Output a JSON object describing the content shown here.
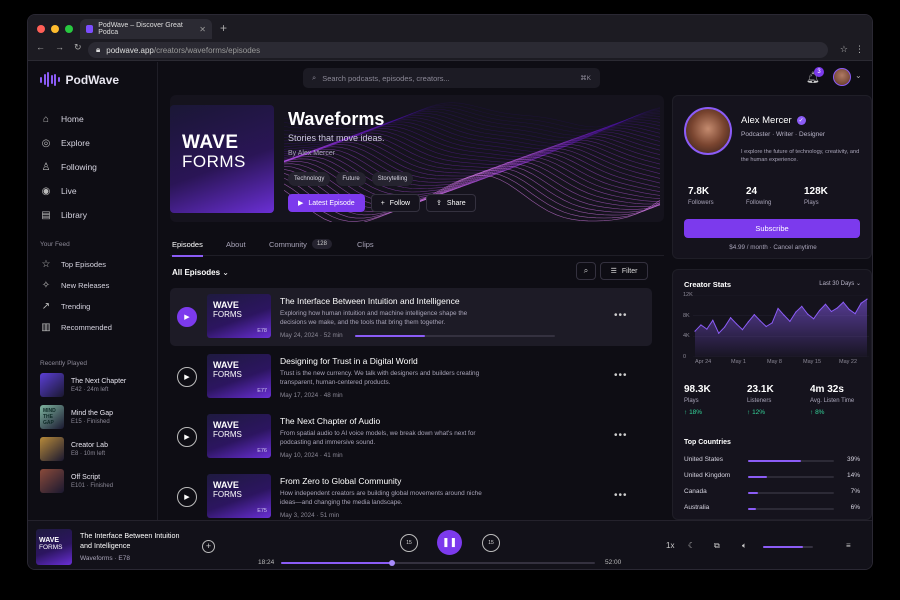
{
  "browser": {
    "tab_title": "PodWave – Discover Great Podca",
    "url_host": "podwave.app",
    "url_path": "/creators/waveforms/episodes"
  },
  "app": {
    "name": "PodWave",
    "accent": "#7c3aed"
  },
  "sidebar": {
    "nav": [
      {
        "label": "Home",
        "icon": "home-icon"
      },
      {
        "label": "Explore",
        "icon": "compass-icon"
      },
      {
        "label": "Following",
        "icon": "user-icon"
      },
      {
        "label": "Live",
        "icon": "live-icon"
      },
      {
        "label": "Library",
        "icon": "library-icon"
      }
    ],
    "feed_heading": "Your Feed",
    "feed": [
      {
        "label": "Top Episodes",
        "icon": "star-icon"
      },
      {
        "label": "New Releases",
        "icon": "sparkle-icon"
      },
      {
        "label": "Trending",
        "icon": "trending-icon"
      },
      {
        "label": "Recommended",
        "icon": "chart-icon"
      }
    ],
    "recent_heading": "Recently Played",
    "recent": [
      {
        "title": "The Next Chapter",
        "ep": "E42",
        "status": "24m left",
        "color": "#5b3fd6"
      },
      {
        "title": "Mind the Gap",
        "ep": "E15",
        "status": "Finished",
        "color": "#7fb5a0",
        "thumb_text": "MIND THE GAP"
      },
      {
        "title": "Creator Lab",
        "ep": "E8",
        "status": "10m left",
        "color": "#b78a3a"
      },
      {
        "title": "Off Script",
        "ep": "E101",
        "status": "Finished",
        "color": "#8a4a3a"
      }
    ]
  },
  "topbar": {
    "search_placeholder": "Search podcasts, episodes, creators...",
    "shortcut": "⌘K",
    "notifications": "3"
  },
  "podcast": {
    "cover_line1": "WAVE",
    "cover_line2": "FORMS",
    "title": "Waveforms",
    "tagline": "Stories that move ideas.",
    "author": "By Alex Mercer",
    "tags": [
      "Technology",
      "Future",
      "Storytelling"
    ],
    "btn_latest": "Latest Episode",
    "btn_follow": "Follow",
    "btn_share": "Share"
  },
  "tabs": [
    {
      "label": "Episodes"
    },
    {
      "label": "About"
    },
    {
      "label": "Community",
      "count": "128"
    },
    {
      "label": "Clips"
    }
  ],
  "filter": {
    "all_label": "All Episodes",
    "filter_label": "Filter"
  },
  "episodes": [
    {
      "title": "The Interface Between Intuition and Intelligence",
      "desc": "Exploring how human intuition and machine intelligence shape the decisions we make, and the tools that bring them together.",
      "date": "May 24, 2024",
      "duration": "52 min",
      "num": "E78",
      "progress": 0.35,
      "selected": true
    },
    {
      "title": "Designing for Trust in a Digital World",
      "desc": "Trust is the new currency. We talk with designers and builders creating transparent, human-centered products.",
      "date": "May 17, 2024",
      "duration": "48 min",
      "num": "E77"
    },
    {
      "title": "The Next Chapter of Audio",
      "desc": "From spatial audio to AI voice models, we break down what's next for podcasting and immersive sound.",
      "date": "May 10, 2024",
      "duration": "41 min",
      "num": "E76"
    },
    {
      "title": "From Zero to Global Community",
      "desc": "How independent creators are building global movements around niche ideas—and changing the media landscape.",
      "date": "May 3, 2024",
      "duration": "51 min",
      "num": "E75"
    }
  ],
  "profile": {
    "name": "Alex Mercer",
    "role": "Podcaster · Writer · Designer",
    "bio": "I explore the future of technology, creativity, and the human experience.",
    "stats": [
      {
        "value": "7.8K",
        "label": "Followers"
      },
      {
        "value": "24",
        "label": "Following"
      },
      {
        "value": "128K",
        "label": "Plays"
      }
    ],
    "subscribe": "Subscribe",
    "price": "$4.99 / month · Cancel anytime"
  },
  "creator_stats": {
    "title": "Creator Stats",
    "range": "Last 30 Days",
    "kpis": [
      {
        "value": "98.3K",
        "label": "Plays",
        "change": "18%"
      },
      {
        "value": "23.1K",
        "label": "Listeners",
        "change": "12%"
      },
      {
        "value": "4m 32s",
        "label": "Avg. Listen Time",
        "change": "8%"
      }
    ],
    "countries_title": "Top Countries",
    "countries": [
      {
        "name": "United States",
        "pct": "39%",
        "value": 39
      },
      {
        "name": "United Kingdom",
        "pct": "14%",
        "value": 14
      },
      {
        "name": "Canada",
        "pct": "7%",
        "value": 7
      },
      {
        "name": "Australia",
        "pct": "6%",
        "value": 6
      }
    ]
  },
  "chart_data": {
    "type": "area",
    "title": "Creator Stats",
    "x_ticks": [
      "Apr 24",
      "May 1",
      "May 8",
      "May 15",
      "May 22"
    ],
    "y_ticks": [
      "12K",
      "8K",
      "4K",
      "0"
    ],
    "ylim": [
      0,
      12000
    ],
    "values": [
      5000,
      6200,
      5400,
      7100,
      4600,
      5800,
      7600,
      6400,
      5300,
      6800,
      8200,
      7000,
      5900,
      6600,
      9400,
      8100,
      6900,
      8700,
      9800,
      8300,
      7400,
      9000,
      10200,
      8800,
      9500,
      10600,
      9200,
      8400,
      10400,
      11200
    ],
    "color": "#8b5cf6"
  },
  "player": {
    "thumb_line1": "WAVE",
    "thumb_line2": "FORMS",
    "title": "The Interface Between Intuition and Intelligence",
    "meta": "Waveforms · E78",
    "skip_back": "15",
    "skip_fwd": "15",
    "time_now": "18:24",
    "time_end": "52:00",
    "progress": 0.354,
    "speed": "1x",
    "volume": 0.8
  }
}
